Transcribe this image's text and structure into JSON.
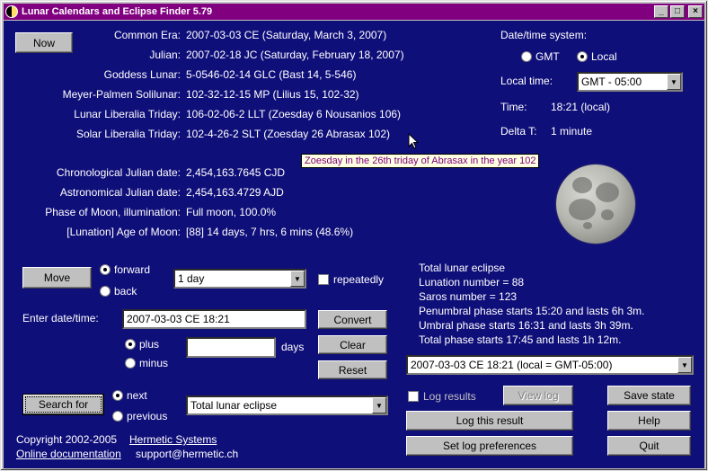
{
  "window": {
    "title": "Lunar Calendars and Eclipse Finder 5.79"
  },
  "titlebar_buttons": {
    "minimize": "_",
    "maximize": "□",
    "close": "×"
  },
  "now_button": "Now",
  "calendars": [
    {
      "label": "Common Era:",
      "value": "2007-03-03 CE (Saturday, March 3, 2007)"
    },
    {
      "label": "Julian:",
      "value": "2007-02-18 JC (Saturday, February 18, 2007)"
    },
    {
      "label": "Goddess Lunar:",
      "value": "5-0546-02-14 GLC (Bast 14, 5-546)"
    },
    {
      "label": "Meyer-Palmen Solilunar:",
      "value": "102-32-12-15 MP (Lilius 15, 102-32)"
    },
    {
      "label": "Lunar Liberalia Triday:",
      "value": "106-02-06-2 LLT (Zoesday 6 Nousanios 106)"
    },
    {
      "label": "Solar Liberalia Triday:",
      "value": "102-4-26-2 SLT (Zoesday 26 Abrasax 102)"
    }
  ],
  "tooltip": "Zoesday in the 26th triday of Abrasax in the year 102",
  "julian_dates": [
    {
      "label": "Chronological Julian date:",
      "value": "2,454,163.7645 CJD"
    },
    {
      "label": "Astronomical Julian date:",
      "value": "2,454,163.4729 AJD"
    },
    {
      "label": "Phase of Moon, illumination:",
      "value": "Full moon, 100.0%"
    },
    {
      "label": "[Lunation] Age of Moon:",
      "value": "[88] 14 days, 7 hrs, 6 mins (48.6%)"
    }
  ],
  "datetime_system": {
    "heading": "Date/time system:",
    "gmt_label": "GMT",
    "local_label": "Local",
    "selected": "Local",
    "local_time_label": "Local time:",
    "local_time_value": "GMT - 05:00",
    "time_label": "Time:",
    "time_value": "18:21 (local)",
    "delta_label": "Delta T:",
    "delta_value": "1 minute"
  },
  "move": {
    "button": "Move",
    "forward": "forward",
    "back": "back",
    "selected": "forward",
    "step_value": "1 day",
    "repeatedly": "repeatedly"
  },
  "enter": {
    "label": "Enter date/time:",
    "value": "2007-03-03 CE 18:21",
    "convert": "Convert",
    "clear": "Clear",
    "reset": "Reset",
    "plus": "plus",
    "minus": "minus",
    "selected": "plus",
    "days_value": "",
    "days_label": "days"
  },
  "search": {
    "button": "Search for",
    "next": "next",
    "previous": "previous",
    "selected": "next",
    "target": "Total lunar eclipse"
  },
  "eclipse_info": [
    "Total lunar eclipse",
    "Lunation number = 88",
    "Saros number = 123",
    "Penumbral phase starts 15:20 and lasts 6h 3m.",
    "Umbral phase starts 16:31 and lasts 3h 39m.",
    "Total phase starts 17:45 and lasts 1h 12m."
  ],
  "eclipse_select": "2007-03-03 CE 18:21 (local = GMT-05:00)",
  "log": {
    "log_results": "Log results",
    "view_log": "View log",
    "log_this": "Log this result",
    "set_prefs": "Set log preferences"
  },
  "right_buttons": {
    "save_state": "Save state",
    "help": "Help",
    "quit": "Quit"
  },
  "footer": {
    "copyright": "Copyright 2002-2005",
    "company": "Hermetic Systems",
    "online_doc": "Online documentation",
    "email": "support@hermetic.ch"
  },
  "colors": {
    "client_bg": "#0f0f7a",
    "titlebar": "#800080",
    "tooltip_text": "#800080"
  },
  "icons": {
    "app": "moon-phase-icon",
    "dropdown": "chevron-down-icon",
    "cursor": "mouse-pointer-icon"
  }
}
